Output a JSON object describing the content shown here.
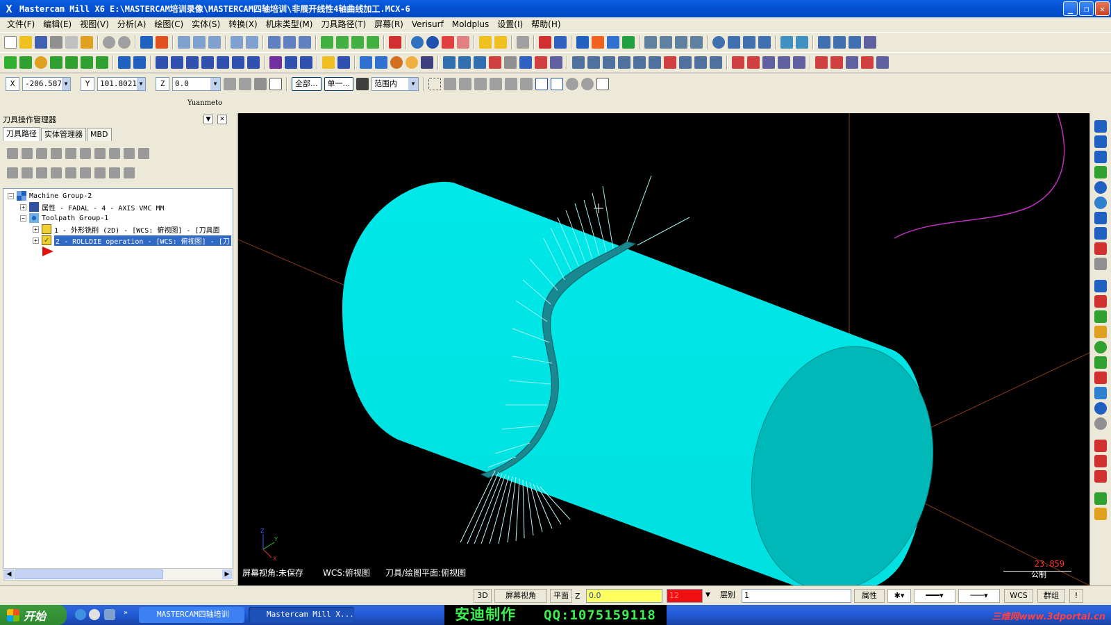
{
  "window": {
    "title": "Mastercam Mill X6  E:\\MASTERCAM培训录像\\MASTERCAM四轴培训\\非展开线性4轴曲线加工.MCX-6",
    "app_icon": "X"
  },
  "menu": [
    "文件(F)",
    "编辑(E)",
    "视图(V)",
    "分析(A)",
    "绘图(C)",
    "实体(S)",
    "转换(X)",
    "机床类型(M)",
    "刀具路径(T)",
    "屏幕(R)",
    "Verisurf",
    "Moldplus",
    "设置(I)",
    "帮助(H)"
  ],
  "coords": {
    "x_label": "X",
    "x_value": "-206.587",
    "y_label": "Y",
    "y_value": "101.8021",
    "z_label": "Z",
    "z_value": "0.0",
    "all_label": "全部...",
    "single_label": "单一...",
    "range_label": "范围内"
  },
  "user_label": "Yuanmeto",
  "panel": {
    "title": "刀具操作管理器",
    "tabs": [
      "刀具路径",
      "实体管理器",
      "MBD"
    ],
    "tree": {
      "machine_group": "Machine Group-2",
      "properties": "属性 - FADAL - 4 - AXIS VMC MM",
      "toolpath_group": "Toolpath Group-1",
      "op1": "1 - 外形铣削 (2D) - [WCS: 俯视图] - [刀具面",
      "op2": "2 - ROLLDIE operation - [WCS: 俯视图] - [刀"
    }
  },
  "viewport": {
    "status_view": "屏幕视角:未保存",
    "status_wcs": "WCS:俯视图",
    "status_plane": "刀具/绘图平面:俯视图",
    "scale_value": "23.859",
    "scale_unit": "公制",
    "colors": {
      "stock": "#00e0e0",
      "stock_shade": "#009aa0",
      "groove": "#1a8890",
      "axis": "#8a3a1a",
      "curve": "#c030c0",
      "scale_num": "#ff3030"
    }
  },
  "statusbar": {
    "mode_3d": "3D",
    "screen_view": "屏幕视角",
    "plane": "平面",
    "z_label": "Z",
    "z_value": "0.0",
    "color_value": "12",
    "level_label": "层别",
    "level_value": "1",
    "attr_label": "属性",
    "wcs_label": "WCS",
    "group_label": "群组",
    "help": "!"
  },
  "taskbar": {
    "start": "开始",
    "task1": "MASTERCAM四轴培训",
    "task2": "Mastercam Mill X...",
    "watermark_text": "安迪制作",
    "watermark_qq": "QQ:1075159118",
    "portal": "三维网www.3dportal.cn"
  }
}
